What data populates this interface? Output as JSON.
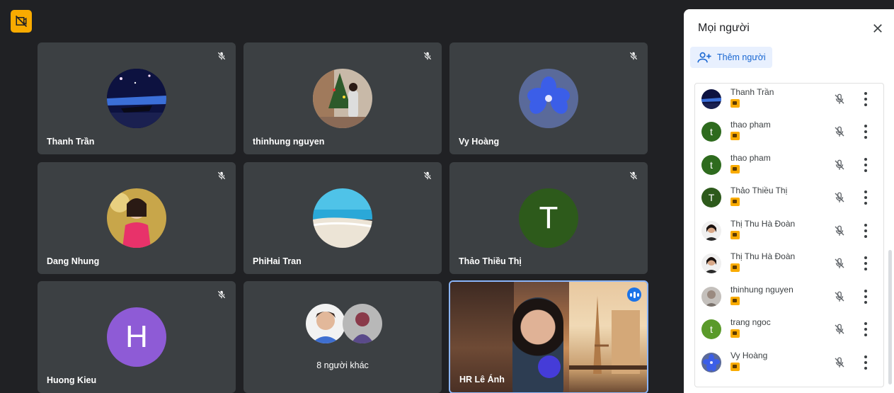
{
  "tiles": [
    {
      "name": "Thanh Trần",
      "avatar": "night-lake-photo"
    },
    {
      "name": "thinhung nguyen",
      "avatar": "christmas-tree-photo"
    },
    {
      "name": "Vy Hoàng",
      "avatar": "blue-flower-photo"
    },
    {
      "name": "Dang Nhung",
      "avatar": "woman-ao-dai-photo"
    },
    {
      "name": "PhiHai Tran",
      "avatar": "beach-photo"
    },
    {
      "name": "Thảo Thiều Thị",
      "initial": "T",
      "color": "#2d5a1b"
    },
    {
      "name": "Huong Kieu",
      "initial": "H",
      "color": "#8e5bd6"
    },
    {
      "name": "8 người khác"
    },
    {
      "name": "HR Lê Ánh",
      "speaking": true
    }
  ],
  "panel": {
    "title": "Mọi người",
    "add_label": "Thêm người",
    "participants": [
      {
        "name": "Thanh Trần",
        "avatar": "photo-night",
        "color": "#1a2a6c"
      },
      {
        "name": "thao pham",
        "initial": "t",
        "color": "#2e6b1e"
      },
      {
        "name": "thao pham",
        "initial": "t",
        "color": "#2e6b1e"
      },
      {
        "name": "Thảo Thiều Thị",
        "initial": "T",
        "color": "#2d5a1b"
      },
      {
        "name": "Thị Thu Hà Đoàn",
        "avatar": "photo-person",
        "color": "#3a3a3a"
      },
      {
        "name": "Thị Thu Hà Đoàn",
        "avatar": "photo-person",
        "color": "#3a3a3a"
      },
      {
        "name": "thinhung nguyen",
        "avatar": "photo-gray",
        "color": "#9e9e9e"
      },
      {
        "name": "trang ngoc",
        "initial": "t",
        "color": "#5a9a2a"
      },
      {
        "name": "Vy Hoàng",
        "avatar": "photo-flower",
        "color": "#4456c6"
      }
    ]
  },
  "colors": {
    "accent": "#1a73e8",
    "badge": "#f9ab00",
    "tile_bg": "#3c4043",
    "page_bg": "#202124"
  }
}
